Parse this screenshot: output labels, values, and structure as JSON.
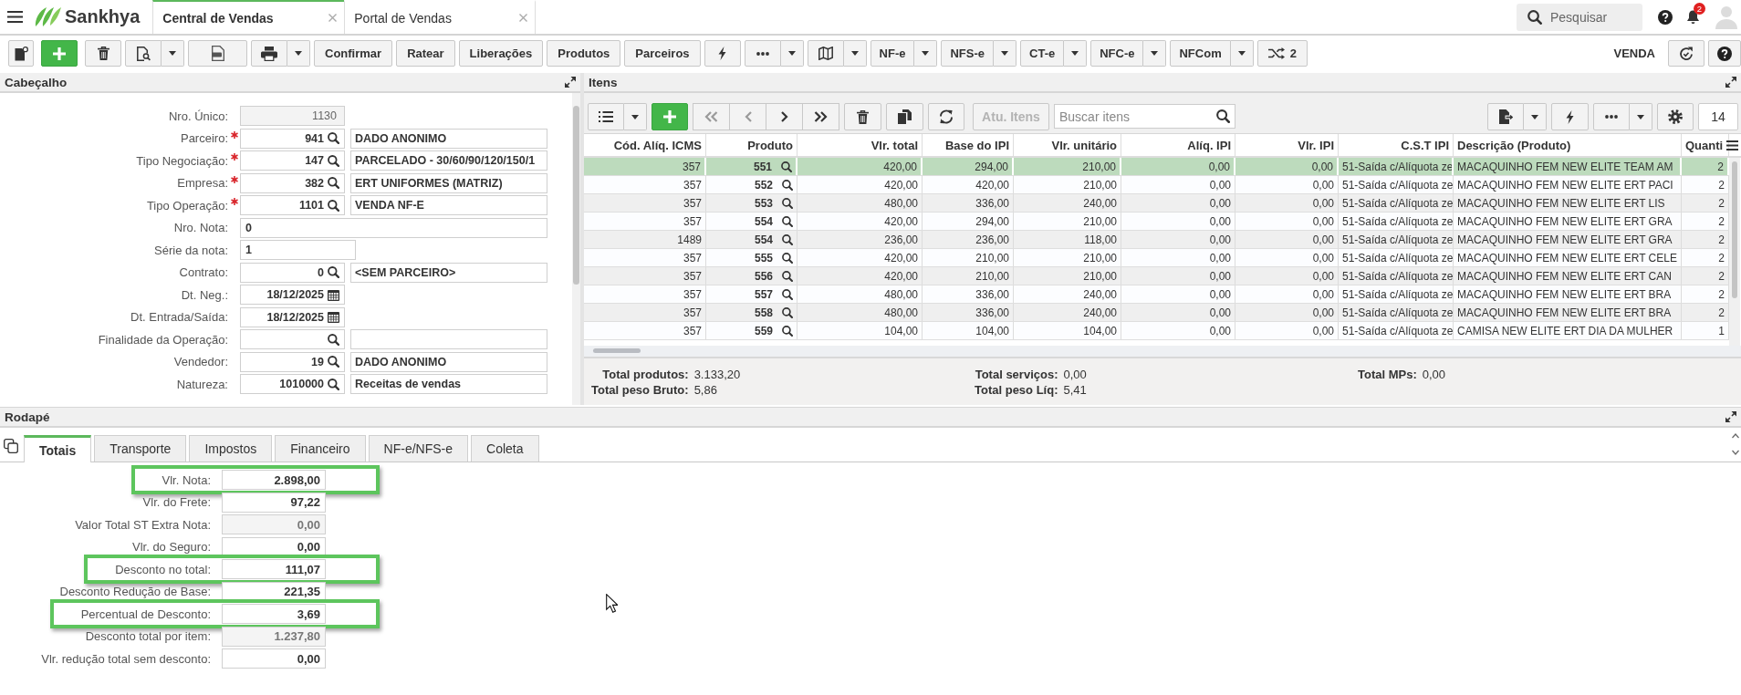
{
  "top_bar": {
    "brand": "Sankhya",
    "tabs": [
      {
        "label": "Central de Vendas",
        "selected": true
      },
      {
        "label": "Portal de Vendas",
        "selected": false
      }
    ],
    "search": {
      "placeholder": "Pesquisar"
    },
    "notifications": {
      "count": "2"
    }
  },
  "toolbar": {
    "actions": [
      "Confirmar",
      "Ratear",
      "Liberações",
      "Produtos",
      "Parceiros"
    ],
    "documents": [
      "NF-e",
      "NFS-e",
      "CT-e",
      "NFC-e",
      "NFCom"
    ],
    "switch_count": "2",
    "mode": "VENDA"
  },
  "cabecalho": {
    "title": "Cabeçalho",
    "fields": [
      {
        "label": "Nro. Único:",
        "kind": "readonly",
        "value": "1130",
        "required": false
      },
      {
        "label": "Parceiro:",
        "kind": "lookup",
        "value": "941",
        "description": "DADO ANONIMO",
        "required": true
      },
      {
        "label": "Tipo Negociação:",
        "kind": "lookup",
        "value": "147",
        "description": "PARCELADO - 30/60/90/120/150/1",
        "required": true
      },
      {
        "label": "Empresa:",
        "kind": "lookup",
        "value": "382",
        "description": "ERT UNIFORMES (MATRIZ)",
        "required": true
      },
      {
        "label": "Tipo Operação:",
        "kind": "lookup",
        "value": "1101",
        "description": "VENDA NF-E",
        "required": true
      },
      {
        "label": "Nro. Nota:",
        "kind": "text",
        "value": "0",
        "required": false
      },
      {
        "label": "Série da nota:",
        "kind": "short",
        "value": "1",
        "required": false
      },
      {
        "label": "Contrato:",
        "kind": "lookup",
        "value": "0",
        "description": "<SEM PARCEIRO>",
        "required": false
      },
      {
        "label": "Dt. Neg.:",
        "kind": "date",
        "value": "18/12/2025",
        "required": false
      },
      {
        "label": "Dt. Entrada/Saída:",
        "kind": "date",
        "value": "18/12/2025",
        "required": false
      },
      {
        "label": "Finalidade da Operação:",
        "kind": "lookup",
        "required": false
      },
      {
        "label": "Vendedor:",
        "kind": "lookup",
        "value": "19",
        "description": "DADO ANONIMO",
        "required": false
      },
      {
        "label": "Natureza:",
        "kind": "lookup",
        "value": "1010000",
        "description": "Receitas de vendas",
        "required": false
      }
    ]
  },
  "itens": {
    "title": "Itens",
    "toolbar": {
      "navigation": [
        {
          "kind": "first",
          "disabled": true
        },
        {
          "kind": "previous",
          "disabled": true
        },
        {
          "kind": "next",
          "disabled": false
        },
        {
          "kind": "last",
          "disabled": false
        }
      ],
      "update_button": {
        "label": "Atu. Itens",
        "disabled": true
      },
      "search": {
        "placeholder": "Buscar itens"
      },
      "page_size": "14"
    },
    "table": {
      "columns": [
        "Cód. Alíq. ICMS",
        "Produto",
        "Vlr. total",
        "Base do IPI",
        "Vlr. unitário",
        "Alíq. IPI",
        "Vlr. IPI",
        "C.S.T IPI",
        "Descrição (Produto)",
        "Quanti"
      ],
      "rows": [
        {
          "cells": [
            "357",
            "551",
            "420,00",
            "294,00",
            "210,00",
            "0,00",
            "0,00",
            "51-Saída c/Alíquota ze",
            "MACAQUINHO FEM NEW ELITE TEAM AM",
            "2"
          ],
          "selected": true
        },
        {
          "cells": [
            "357",
            "552",
            "420,00",
            "420,00",
            "210,00",
            "0,00",
            "0,00",
            "51-Saída c/Alíquota ze",
            "MACAQUINHO FEM NEW ELITE ERT PACI",
            "2"
          ],
          "selected": false
        },
        {
          "cells": [
            "357",
            "553",
            "480,00",
            "336,00",
            "240,00",
            "0,00",
            "0,00",
            "51-Saída c/Alíquota ze",
            "MACAQUINHO FEM NEW ELITE ERT LIS",
            "2"
          ],
          "selected": false
        },
        {
          "cells": [
            "357",
            "554",
            "420,00",
            "294,00",
            "210,00",
            "0,00",
            "0,00",
            "51-Saída c/Alíquota ze",
            "MACAQUINHO FEM NEW ELITE ERT GRA",
            "2"
          ],
          "selected": false
        },
        {
          "cells": [
            "1489",
            "554",
            "236,00",
            "236,00",
            "118,00",
            "0,00",
            "0,00",
            "51-Saída c/Alíquota ze",
            "MACAQUINHO FEM NEW ELITE ERT GRA",
            "2"
          ],
          "selected": false
        },
        {
          "cells": [
            "357",
            "555",
            "420,00",
            "210,00",
            "210,00",
            "0,00",
            "0,00",
            "51-Saída c/Alíquota ze",
            "MACAQUINHO FEM NEW ELITE ERT CELE",
            "2"
          ],
          "selected": false
        },
        {
          "cells": [
            "357",
            "556",
            "420,00",
            "210,00",
            "210,00",
            "0,00",
            "0,00",
            "51-Saída c/Alíquota ze",
            "MACAQUINHO FEM NEW ELITE ERT CAN",
            "2"
          ],
          "selected": false
        },
        {
          "cells": [
            "357",
            "557",
            "480,00",
            "336,00",
            "240,00",
            "0,00",
            "0,00",
            "51-Saída c/Alíquota ze",
            "MACAQUINHO FEM NEW ELITE ERT BRA",
            "2"
          ],
          "selected": false
        },
        {
          "cells": [
            "357",
            "558",
            "480,00",
            "336,00",
            "240,00",
            "0,00",
            "0,00",
            "51-Saída c/Alíquota ze",
            "MACAQUINHO FEM NEW ELITE ERT BRA",
            "2"
          ],
          "selected": false
        },
        {
          "cells": [
            "357",
            "559",
            "104,00",
            "104,00",
            "104,00",
            "0,00",
            "0,00",
            "51-Saída c/Alíquota ze",
            "CAMISA NEW ELITE ERT DIA DA MULHER",
            "1"
          ],
          "selected": false
        }
      ]
    },
    "totals": [
      {
        "items": [
          {
            "label": "Total produtos:",
            "value": "3.133,20"
          },
          {
            "label": "Total peso Bruto:",
            "value": "5,86"
          }
        ]
      },
      {
        "items": [
          {
            "label": "Total serviços:",
            "value": "0,00"
          },
          {
            "label": "Total peso Líq:",
            "value": "5,41"
          }
        ]
      },
      {
        "items": [
          {
            "label": "Total MPs:",
            "value": "0,00"
          }
        ]
      }
    ]
  },
  "rodape": {
    "title": "Rodapé",
    "tabs": [
      {
        "label": "Totais",
        "selected": true
      },
      {
        "label": "Transporte",
        "selected": false
      },
      {
        "label": "Impostos",
        "selected": false
      },
      {
        "label": "Financeiro",
        "selected": false
      },
      {
        "label": "NF-e/NFS-e",
        "selected": false
      },
      {
        "label": "Coleta",
        "selected": false
      }
    ],
    "fields": [
      {
        "label": "Vlr. Nota:",
        "value": "2.898,00",
        "disabled": false,
        "highlighted": true
      },
      {
        "label": "Vlr. do Frete:",
        "value": "97,22",
        "disabled": false,
        "highlighted": false
      },
      {
        "label": "Valor Total ST Extra Nota:",
        "value": "0,00",
        "disabled": true,
        "highlighted": false
      },
      {
        "label": "Vlr. do Seguro:",
        "value": "0,00",
        "disabled": false,
        "highlighted": false
      },
      {
        "label": "Desconto no total:",
        "value": "111,07",
        "disabled": false,
        "highlighted": true
      },
      {
        "label": "Desconto Redução de Base:",
        "value": "221,35",
        "disabled": false,
        "highlighted": false
      },
      {
        "label": "Percentual de Desconto:",
        "value": "3,69",
        "disabled": false,
        "highlighted": true
      },
      {
        "label": "Desconto total por item:",
        "value": "1.237,80",
        "disabled": true,
        "highlighted": false
      },
      {
        "label": "Vlr. redução total sem desconto:",
        "value": "0,00",
        "disabled": false,
        "highlighted": false
      }
    ]
  }
}
